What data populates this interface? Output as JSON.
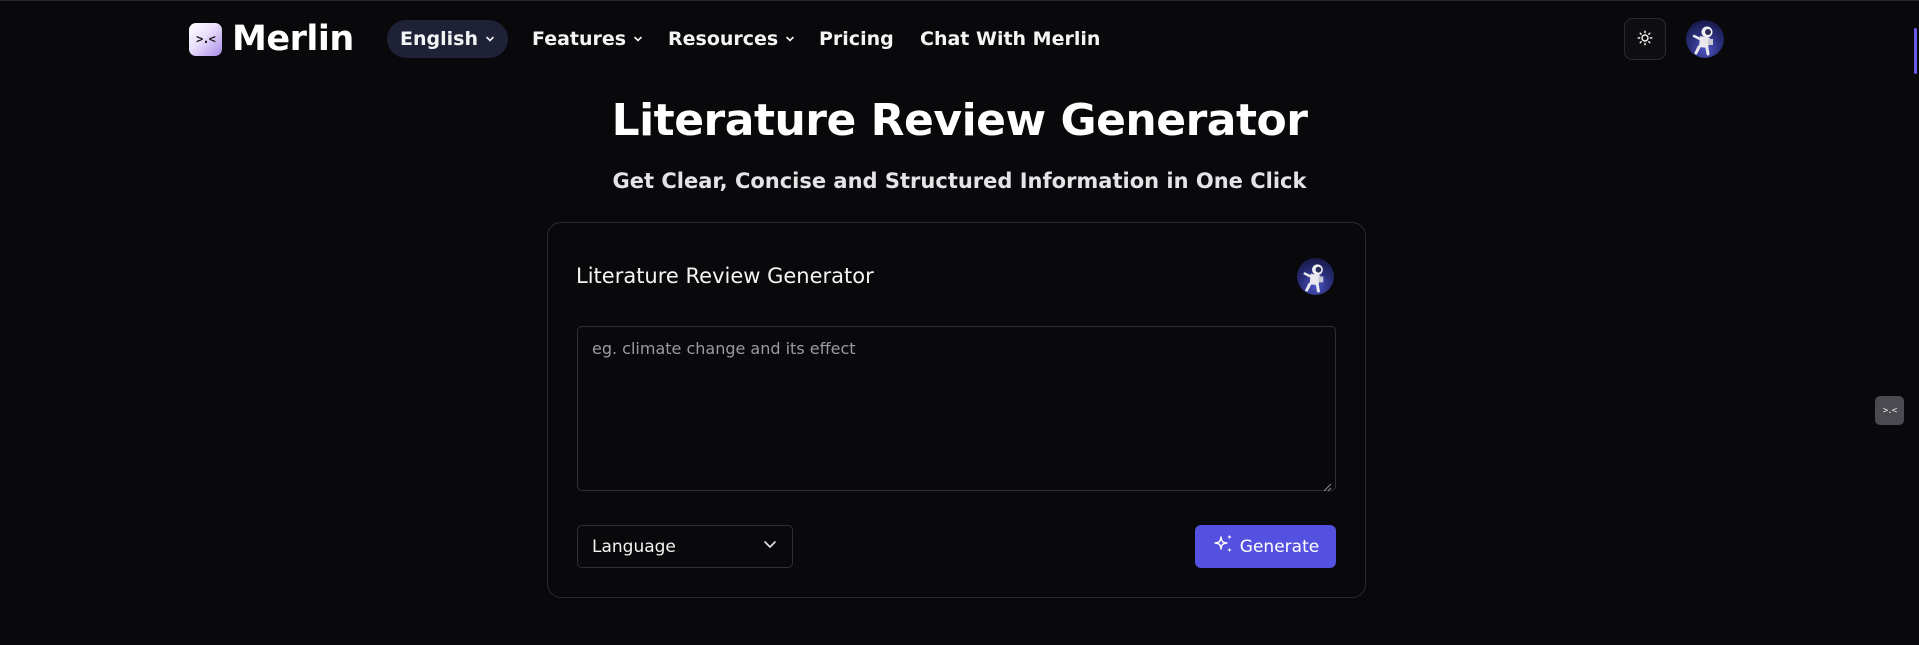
{
  "brand": {
    "name": "Merlin",
    "logo_glyph": ">.<"
  },
  "nav": {
    "language": "English",
    "items": [
      {
        "label": "Features"
      },
      {
        "label": "Resources"
      },
      {
        "label": "Pricing"
      },
      {
        "label": "Chat With Merlin"
      }
    ],
    "icons": {
      "chevron": "chevron-down-icon",
      "theme": "sun-icon",
      "avatar": "astronaut-avatar"
    }
  },
  "page": {
    "title": "Literature Review Generator",
    "subtitle": "Get Clear, Concise and Structured Information in One Click"
  },
  "tool": {
    "card_title": "Literature Review Generator",
    "input_placeholder": "eg. climate change and its effect",
    "input_value": "",
    "language_select": "Language",
    "generate_label": "Generate",
    "generate_icon": "sparkles-icon"
  },
  "colors": {
    "background": "#09090b",
    "accent": "#5551e0",
    "language_pill": "#1f2236",
    "border": "#2a2a30"
  }
}
